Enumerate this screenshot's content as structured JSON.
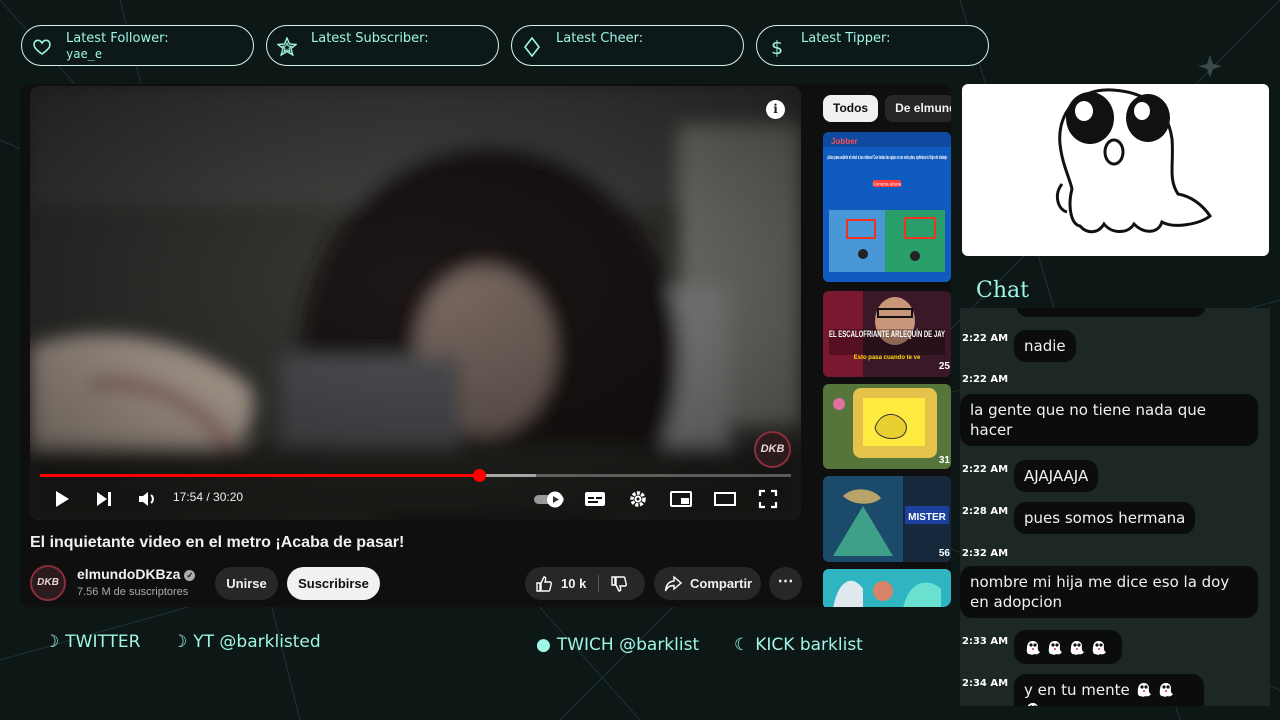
{
  "alerts": [
    {
      "label": "Latest Follower:",
      "value": "yae_e",
      "icon": "heart-icon"
    },
    {
      "label": "Latest Subscriber:",
      "value": "",
      "icon": "star-icon"
    },
    {
      "label": "Latest Cheer:",
      "value": "",
      "icon": "diamond-icon"
    },
    {
      "label": "Latest Tipper:",
      "value": "",
      "icon": "dollar-icon"
    }
  ],
  "player": {
    "time": "17:54 / 30:20",
    "progress": 0.585,
    "buffered": 0.66,
    "watermark": "DKB"
  },
  "video": {
    "title": "El inquietante video en el metro ¡Acaba de pasar!",
    "channel": "elmundoDKBza",
    "subscribers": "7.56 M de suscriptores",
    "avatar_text": "DKB",
    "join_label": "Unirse",
    "subscribe_label": "Suscribirse",
    "likes": "10 k",
    "share_label": "Compartir"
  },
  "sidebar": {
    "chips": [
      "Todos",
      "De elmundoDKBza"
    ],
    "thumbs": [
      {
        "overlay": "Jobber",
        "caption": "¡Listo para subirle el nivel a tus videos! Con todas las apps en un solo plan, optimiza tu flujo de trabajo",
        "cta": "Compra ahora"
      },
      {
        "overlay": "EL ESCALOFRIANTE ARLEQUÍN DE JAY",
        "sub": "Esto pasa cuando te ve",
        "badge": "25"
      },
      {
        "badge": "31"
      },
      {
        "overlay": "MISTER",
        "badge": "56"
      },
      {}
    ]
  },
  "chat": {
    "title": "Chat",
    "messages": [
      {
        "time": "2:22 AM",
        "text": "nadie"
      },
      {
        "time": "2:22 AM",
        "text": "la gente que no tiene nada que hacer"
      },
      {
        "time": "2:22 AM",
        "text": "AJAJAAJA"
      },
      {
        "time": "2:28 AM",
        "text": "pues somos hermana"
      },
      {
        "time": "2:32 AM",
        "text": "nombre mi hija me dice eso la doy en adopcion"
      },
      {
        "time": "2:33 AM",
        "text": ""
      },
      {
        "time": "2:34 AM",
        "text": "y en tu mente"
      }
    ]
  },
  "socials": [
    {
      "label": "TWITTER",
      "icon": "moon-icon"
    },
    {
      "label": "YT @barklisted",
      "icon": "moon-icon"
    },
    {
      "label": "TWICH @barklist",
      "icon": "circle-icon"
    },
    {
      "label": "KICK barklist",
      "icon": "moon-icon"
    }
  ],
  "colors": {
    "accent": "#9ff5e6",
    "yt_red": "#ff0000",
    "bg": "#0c1716"
  }
}
